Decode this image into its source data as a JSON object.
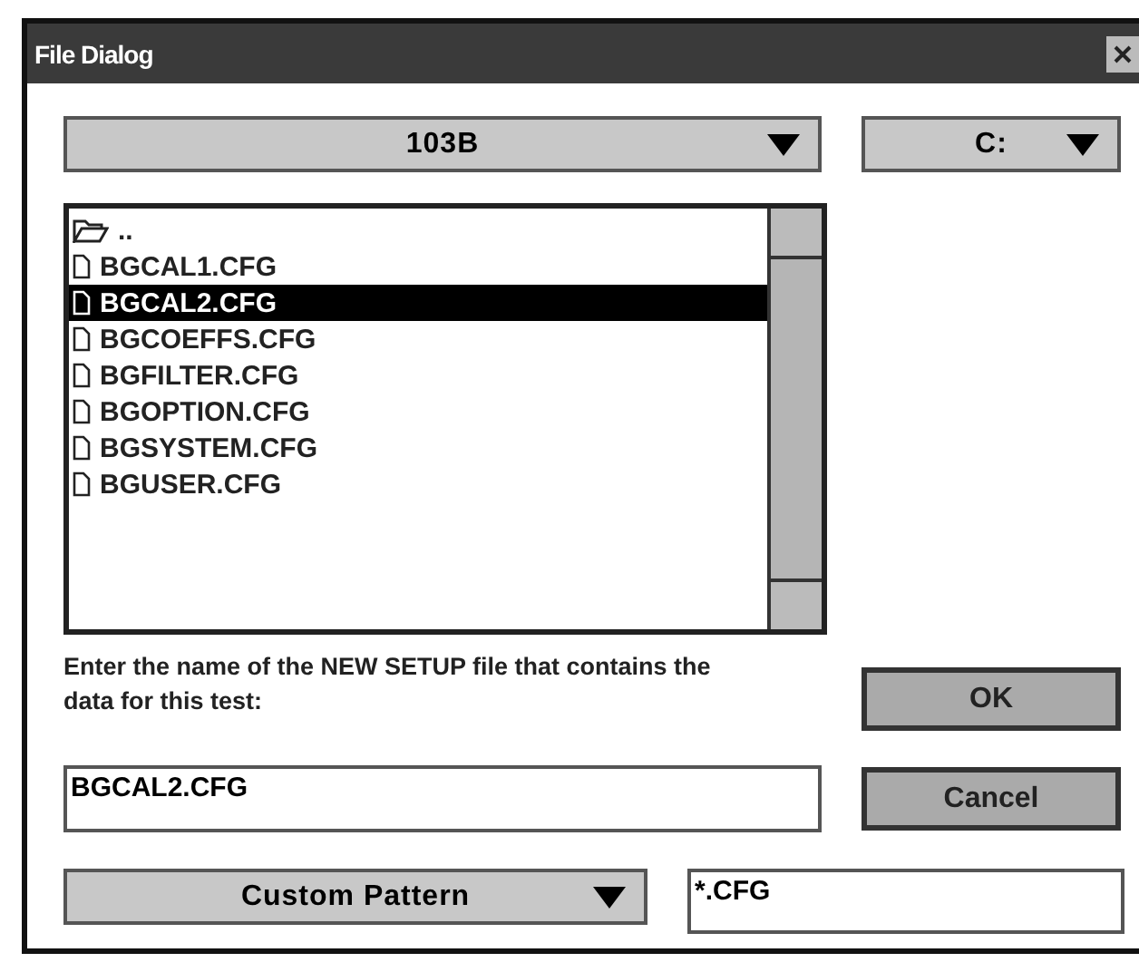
{
  "window": {
    "title": "File Dialog"
  },
  "directory_dropdown": {
    "value": "103B"
  },
  "drive_dropdown": {
    "value": "C:"
  },
  "file_list": [
    {
      "kind": "folder",
      "label": "..",
      "selected": false
    },
    {
      "kind": "file",
      "label": "BGCAL1.CFG",
      "selected": false
    },
    {
      "kind": "file",
      "label": "BGCAL2.CFG",
      "selected": true
    },
    {
      "kind": "file",
      "label": "BGCOEFFS.CFG",
      "selected": false
    },
    {
      "kind": "file",
      "label": "BGFILTER.CFG",
      "selected": false
    },
    {
      "kind": "file",
      "label": "BGOPTION.CFG",
      "selected": false
    },
    {
      "kind": "file",
      "label": "BGSYSTEM.CFG",
      "selected": false
    },
    {
      "kind": "file",
      "label": "BGUSER.CFG",
      "selected": false
    }
  ],
  "prompt": "Enter the name of the NEW SETUP file that contains the data for this test:",
  "filename_field": {
    "value": "BGCAL2.CFG"
  },
  "pattern_dropdown": {
    "value": "Custom Pattern"
  },
  "pattern_field": {
    "value": "*.CFG"
  },
  "buttons": [
    "OK",
    "Cancel"
  ]
}
